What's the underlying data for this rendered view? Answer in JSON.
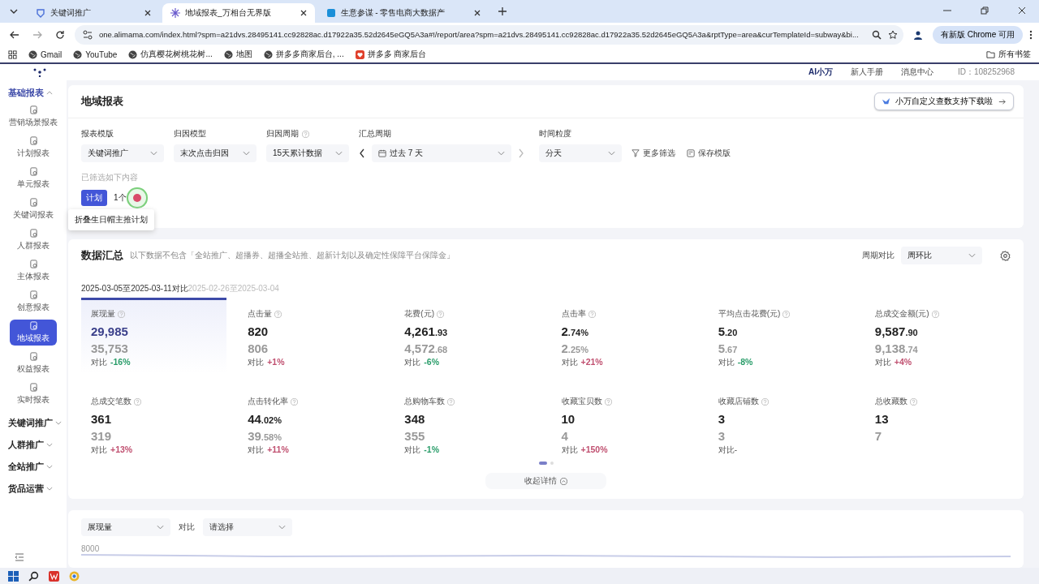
{
  "browser": {
    "tabs": [
      {
        "title": "关键词推广",
        "selected": false
      },
      {
        "title": "地域报表_万相台无界版",
        "selected": true
      },
      {
        "title": "生意参谋 - 零售电商大数据产",
        "selected": false
      }
    ],
    "url": "one.alimama.com/index.html?spm=a21dvs.28495141.cc92828ac.d17922a35.52d2645eGQ5A3a#!/report/area?spm=a21dvs.28495141.cc92828ac.d17922a35.52d2645eGQ5A3a&rptType=area&curTemplateId=subway&bi...",
    "update_button": "有新版 Chrome 可用",
    "bookmarks": [
      {
        "label": "Gmail",
        "kind": "globe"
      },
      {
        "label": "YouTube",
        "kind": "globe"
      },
      {
        "label": "仿真樱花树桃花树...",
        "kind": "globe"
      },
      {
        "label": "地图",
        "kind": "globe"
      },
      {
        "label": "拼多多商家后台, ...",
        "kind": "globe"
      },
      {
        "label": "拼多多 商家后台",
        "kind": "heart"
      }
    ],
    "all_bookmarks": "所有书签"
  },
  "header": {
    "assistant": "AI小万",
    "links": [
      "新人手册",
      "消息中心"
    ],
    "account_id": "ID：108252968"
  },
  "sidebar": {
    "groups": [
      {
        "label": "基础报表",
        "expanded": true,
        "items": [
          {
            "label": "营销场景报表",
            "selected": false
          },
          {
            "label": "计划报表",
            "selected": false
          },
          {
            "label": "单元报表",
            "selected": false
          },
          {
            "label": "关键词报表",
            "selected": false
          },
          {
            "label": "人群报表",
            "selected": false
          },
          {
            "label": "主体报表",
            "selected": false
          },
          {
            "label": "创意报表",
            "selected": false
          },
          {
            "label": "地域报表",
            "selected": true
          },
          {
            "label": "权益报表",
            "selected": false
          },
          {
            "label": "实时报表",
            "selected": false
          }
        ]
      },
      {
        "label": "关键词推广",
        "expanded": false
      },
      {
        "label": "人群推广",
        "expanded": false
      },
      {
        "label": "全站推广",
        "expanded": false
      },
      {
        "label": "货品运营",
        "expanded": false
      }
    ]
  },
  "report": {
    "title": "地域报表",
    "promo_button": "小万自定义查数支持下载啦",
    "filters": [
      {
        "label": "报表模版",
        "value": "关键词推广",
        "help": false,
        "kind": "select"
      },
      {
        "label": "归因模型",
        "value": "末次点击归因",
        "help": false,
        "kind": "select"
      },
      {
        "label": "归因周期",
        "value": "15天累计数据",
        "help": true,
        "kind": "select"
      },
      {
        "label": "汇总周期",
        "value": "过去 7 天",
        "help": false,
        "kind": "date"
      },
      {
        "label": "时间粒度",
        "value": "分天",
        "help": false,
        "kind": "select"
      }
    ],
    "actions": [
      {
        "label": "更多筛选",
        "kind": "filter"
      },
      {
        "label": "保存模版",
        "kind": "save"
      }
    ],
    "filtered_label": "已筛选如下内容",
    "chip": "计划",
    "chip_count": "1个",
    "tooltip": "折叠生日帽主推计划"
  },
  "summary": {
    "title": "数据汇总",
    "note": "以下数据不包含「全站推广、超播券、超播全站推、超新计划以及确定性保障平台保障金」",
    "compare_label": "周期对比",
    "compare_value": "周环比",
    "period": "2025-03-05至2025-03-11对比",
    "prev_period": "2025-02-26至2025-03-04",
    "metrics": [
      {
        "label": "展现量",
        "value": "29,985",
        "prev": "35,753",
        "change_label": "对比",
        "change": "-16%",
        "color": "#2a9d6a",
        "selected": true
      },
      {
        "label": "点击量",
        "value": "820",
        "prev": "806",
        "change_label": "对比",
        "change": "+1%",
        "color": "#c05070",
        "selected": false
      },
      {
        "label": "花费(元)",
        "value": "4,261",
        "value_decimal": ".93",
        "prev": "4,572",
        "prev_decimal": ".68",
        "change_label": "对比",
        "change": "-6%",
        "color": "#2a9d6a",
        "selected": false
      },
      {
        "label": "点击率",
        "value": "2",
        "value_decimal": ".74%",
        "prev": "2",
        "prev_decimal": ".25%",
        "change_label": "对比",
        "change": "+21%",
        "color": "#c05070",
        "selected": false
      },
      {
        "label": "平均点击花费(元)",
        "value": "5",
        "value_decimal": ".20",
        "prev": "5",
        "prev_decimal": ".67",
        "change_label": "对比",
        "change": "-8%",
        "color": "#2a9d6a",
        "selected": false
      },
      {
        "label": "总成交金额(元)",
        "value": "9,587",
        "value_decimal": ".90",
        "prev": "9,138",
        "prev_decimal": ".74",
        "change_label": "对比",
        "change": "+4%",
        "color": "#c05070",
        "selected": false
      },
      {
        "label": "总成交笔数",
        "value": "361",
        "prev": "319",
        "change_label": "对比",
        "change": "+13%",
        "color": "#c05070",
        "selected": false
      },
      {
        "label": "点击转化率",
        "value": "44",
        "value_decimal": ".02%",
        "prev": "39",
        "prev_decimal": ".58%",
        "change_label": "对比",
        "change": "+11%",
        "color": "#c05070",
        "selected": false
      },
      {
        "label": "总购物车数",
        "value": "348",
        "prev": "355",
        "change_label": "对比",
        "change": "-1%",
        "color": "#2a9d6a",
        "selected": false
      },
      {
        "label": "收藏宝贝数",
        "value": "10",
        "prev": "4",
        "change_label": "对比",
        "change": "+150%",
        "color": "#c05070",
        "selected": false
      },
      {
        "label": "收藏店铺数",
        "value": "3",
        "prev": "3",
        "change_label": "对比-",
        "selected": false
      },
      {
        "label": "总收藏数",
        "value": "13",
        "prev": "7",
        "selected": false
      }
    ],
    "pages": [
      {
        "selected": true
      },
      {
        "selected": false
      }
    ],
    "collapse": "收起详情"
  },
  "chart_controls": {
    "metric": "展现量",
    "compare_label": "对比",
    "compare_placeholder": "请选择",
    "axis_label": "8000"
  }
}
